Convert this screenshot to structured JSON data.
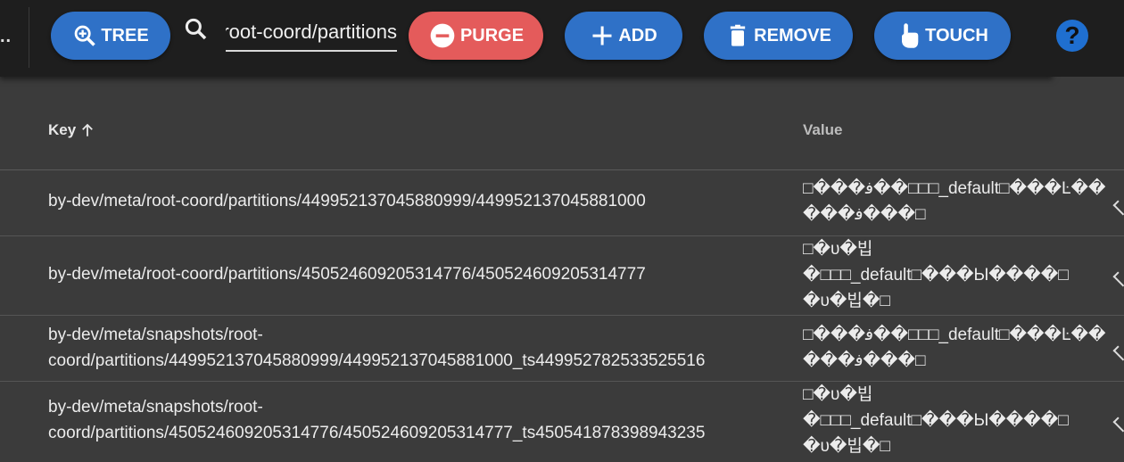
{
  "toolbar": {
    "overflow_dots": "..",
    "tree_label": "TREE",
    "search_value": "by-dev/meta/root-coord/partitions",
    "purge_label": "PURGE",
    "add_label": "ADD",
    "remove_label": "REMOVE",
    "touch_label": "TOUCH",
    "help_label": "?",
    "colors": {
      "primary": "#2f71c7",
      "danger": "#e45b5b",
      "help": "#1f6fd0"
    }
  },
  "table": {
    "columns": [
      {
        "label": "Key",
        "sort": "ascending"
      },
      {
        "label": "Value"
      }
    ],
    "rows": [
      {
        "key": "by-dev/meta/root-coord/partitions/449952137045880999/449952137045881000",
        "value": "□���ﻓ��□□□_default□���Ŀ��\n���ﻓ���□"
      },
      {
        "key": "by-dev/meta/root-coord/partitions/450524609205314776/450524609205314777",
        "value": "□�ᴜ�빕\n�□□□_default□���Ы����□\n�ᴜ�빕�□"
      },
      {
        "key": "by-dev/meta/snapshots/root-coord/partitions/449952137045880999/449952137045881000_ts449952782533525516",
        "value": "□���ﻓ��□□□_default□���Ŀ��\n���ﻓ���□"
      },
      {
        "key": "by-dev/meta/snapshots/root-coord/partitions/450524609205314776/450524609205314777_ts450541878398943235",
        "value": "□�ᴜ�빕\n�□□□_default□���Ы����□\n�ᴜ�빕�□"
      }
    ]
  }
}
